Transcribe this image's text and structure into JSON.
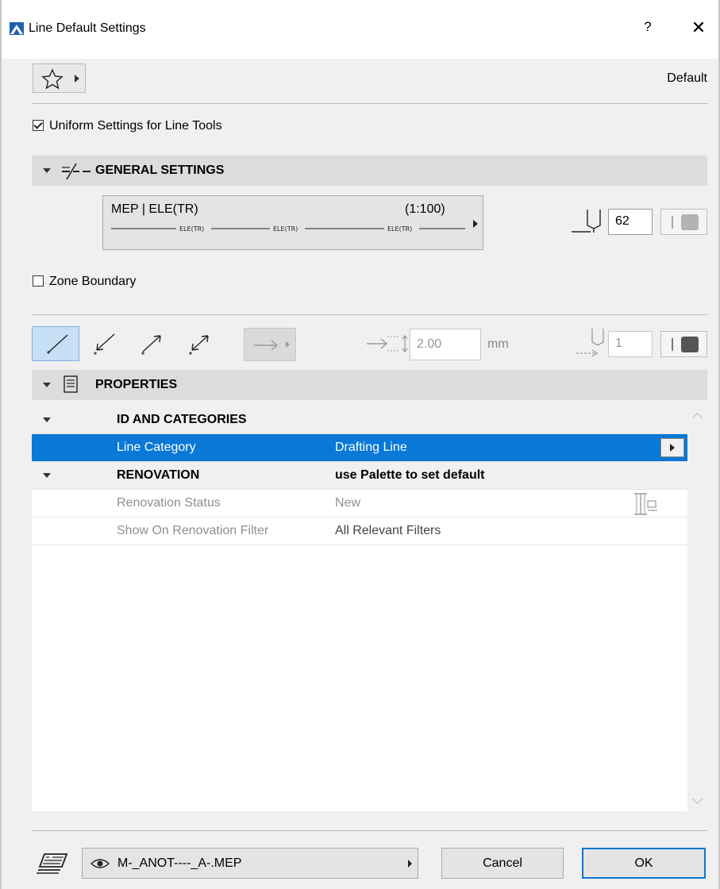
{
  "window": {
    "title": "Line Default Settings",
    "help_label": "?",
    "close_label": "✕"
  },
  "favorites": {
    "default_label": "Default"
  },
  "uniform_settings": {
    "label": "Uniform Settings for Line Tools",
    "checked": true
  },
  "general_settings": {
    "title": "GENERAL SETTINGS",
    "line_type": {
      "name": "MEP | ELE(TR)",
      "scale": "(1:100)",
      "pattern_text": "ELE(TR)"
    },
    "pen_number": "62"
  },
  "zone_boundary": {
    "label": "Zone Boundary",
    "checked": false
  },
  "arrow_settings": {
    "size_value": "2.00",
    "size_unit": "mm",
    "arrow_pen": "1"
  },
  "properties": {
    "title": "PROPERTIES",
    "rows": [
      {
        "type": "group",
        "name": "ID AND CATEGORIES",
        "value": ""
      },
      {
        "type": "selected",
        "name": "Line Category",
        "value": "Drafting Line"
      },
      {
        "type": "group",
        "name": "RENOVATION",
        "value": "use Palette to set default"
      },
      {
        "type": "item",
        "name": "Renovation Status",
        "value": "New"
      },
      {
        "type": "item",
        "name": "Show On Renovation Filter",
        "value": "All Relevant Filters"
      }
    ]
  },
  "footer": {
    "layer_name": "M-_ANOT----_A-.MEP",
    "cancel_label": "Cancel",
    "ok_label": "OK"
  },
  "colors": {
    "accent": "#0a78d7",
    "section_header_bg": "#dcdcdc",
    "dialog_bg": "#f0f0f0"
  }
}
